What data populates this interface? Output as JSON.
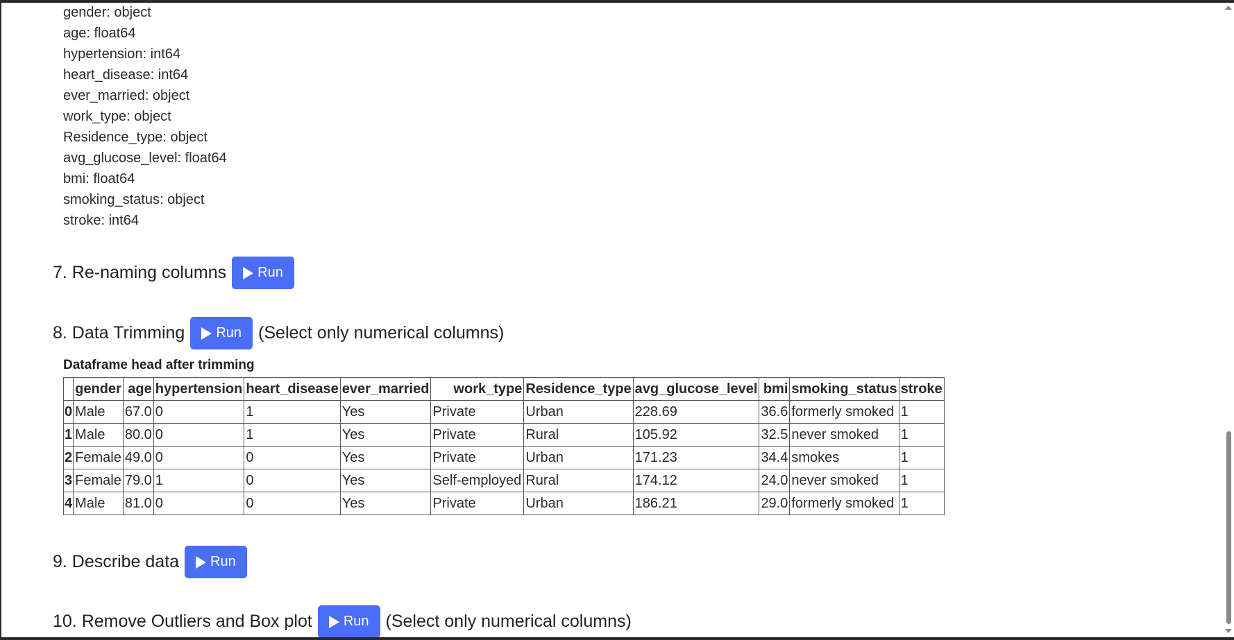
{
  "dtypes": [
    "gender: object",
    "age: float64",
    "hypertension: int64",
    "heart_disease: int64",
    "ever_married: object",
    "work_type: object",
    "Residence_type: object",
    "avg_glucose_level: float64",
    "bmi: float64",
    "smoking_status: object",
    "stroke: int64"
  ],
  "run_label": "Run",
  "sections": {
    "s7": {
      "title": "7. Re-naming columns"
    },
    "s8": {
      "title": "8. Data Trimming",
      "note": "(Select only numerical columns)"
    },
    "s9": {
      "title": "9. Describe data"
    },
    "s10": {
      "title": "10. Remove Outliers and Box plot",
      "note": "(Select only numerical columns)"
    }
  },
  "dataframe": {
    "caption": "Dataframe head after trimming",
    "columns": [
      "gender",
      "age",
      "hypertension",
      "heart_disease",
      "ever_married",
      "work_type",
      "Residence_type",
      "avg_glucose_level",
      "bmi",
      "smoking_status",
      "stroke"
    ],
    "rows": [
      {
        "index": "0",
        "cells": [
          "Male",
          "67.0",
          "0",
          "1",
          "Yes",
          "Private",
          "Urban",
          "228.69",
          "36.6",
          "formerly smoked",
          "1"
        ]
      },
      {
        "index": "1",
        "cells": [
          "Male",
          "80.0",
          "0",
          "1",
          "Yes",
          "Private",
          "Rural",
          "105.92",
          "32.5",
          "never smoked",
          "1"
        ]
      },
      {
        "index": "2",
        "cells": [
          "Female",
          "49.0",
          "0",
          "0",
          "Yes",
          "Private",
          "Urban",
          "171.23",
          "34.4",
          "smokes",
          "1"
        ]
      },
      {
        "index": "3",
        "cells": [
          "Female",
          "79.0",
          "1",
          "0",
          "Yes",
          "Self-employed",
          "Rural",
          "174.12",
          "24.0",
          "never smoked",
          "1"
        ]
      },
      {
        "index": "4",
        "cells": [
          "Male",
          "81.0",
          "0",
          "0",
          "Yes",
          "Private",
          "Urban",
          "186.21",
          "29.0",
          "formerly smoked",
          "1"
        ]
      }
    ]
  },
  "colors": {
    "run_button": "#4a6ef5",
    "scroll_thumb": "#8a8a8a"
  }
}
